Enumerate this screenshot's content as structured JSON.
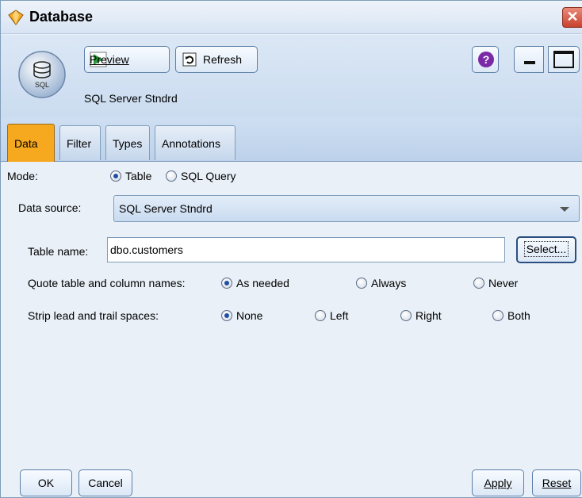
{
  "window": {
    "title": "Database",
    "close_glyph": "✕"
  },
  "header": {
    "node_icon_label": "SQL",
    "preview_label": "Preview",
    "refresh_label": "Refresh",
    "help_glyph": "?",
    "node_name": "SQL Server Stndrd"
  },
  "tabs": [
    {
      "label": "Data",
      "active": true
    },
    {
      "label": "Filter",
      "active": false
    },
    {
      "label": "Types",
      "active": false
    },
    {
      "label": "Annotations",
      "active": false
    }
  ],
  "form": {
    "mode_label": "Mode:",
    "mode_options": [
      {
        "label": "Table",
        "selected": true
      },
      {
        "label": "SQL Query",
        "selected": false
      }
    ],
    "data_source_label": "Data source:",
    "data_source_value": "SQL Server Stndrd",
    "table_name_label": "Table name:",
    "table_name_value": "dbo.customers",
    "select_button_label": "Select...",
    "quote_label": "Quote table and column names:",
    "quote_options": [
      {
        "label": "As needed",
        "selected": true
      },
      {
        "label": "Always",
        "selected": false
      },
      {
        "label": "Never",
        "selected": false
      }
    ],
    "strip_label": "Strip lead and trail spaces:",
    "strip_options": [
      {
        "label": "None",
        "selected": true
      },
      {
        "label": "Left",
        "selected": false
      },
      {
        "label": "Right",
        "selected": false
      },
      {
        "label": "Both",
        "selected": false
      }
    ]
  },
  "footer": {
    "ok_label": "OK",
    "cancel_label": "Cancel",
    "apply_label": "Apply",
    "reset_label": "Reset"
  },
  "colors": {
    "active_tab": "#f6a81f",
    "radio_selected": "#1f4fa4",
    "preview_icon": "#2a9a3a",
    "help_icon": "#7b2aa7"
  }
}
